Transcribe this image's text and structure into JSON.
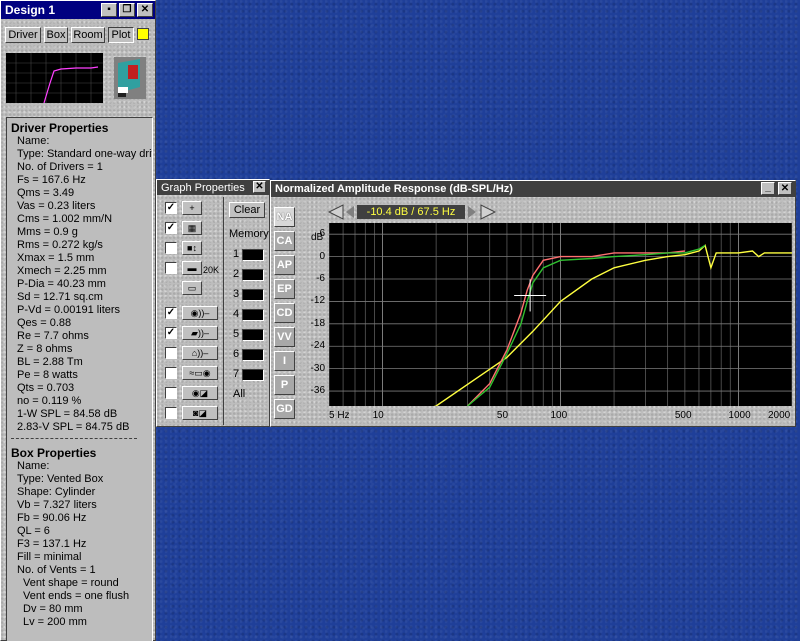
{
  "design": {
    "title": "Design 1",
    "tabs": [
      "Driver",
      "Box",
      "Room",
      "Plot"
    ],
    "driver_heading": "Driver Properties",
    "driver_lines": [
      "Name:",
      "Type: Standard one-way driver",
      "No. of Drivers = 1",
      "Fs =  167.6 Hz",
      "Qms =  3.49",
      "Vas =  0.23 liters",
      "Cms =  1.002 mm/N",
      "Mms =  0.9 g",
      "Rms =  0.272 kg/s",
      "Xmax =  1.5 mm",
      "Xmech =  2.25 mm",
      "P-Dia =  40.23 mm",
      "Sd =  12.71 sq.cm",
      "P-Vd =  0.00191 liters",
      "Qes =  0.88",
      "Re =  7.7 ohms",
      "Z =  8 ohms",
      "BL =  2.88 Tm",
      "Pe =  8 watts",
      "Qts =  0.703",
      "no =  0.119 %",
      "1-W SPL =  84.58 dB",
      "2.83-V SPL =  84.75 dB"
    ],
    "box_heading": "Box Properties",
    "box_lines": [
      "Name:",
      "Type: Vented Box",
      "Shape: Cylinder",
      "Vb =  7.327 liters",
      "Fb =  90.06 Hz",
      "QL =  6",
      "F3 =  137.1 Hz",
      "Fill = minimal",
      "No. of Vents = 1",
      "Vent shape = round",
      "Vent ends = one flush",
      "Dv =  80 mm",
      "Lv =  200 mm"
    ]
  },
  "graph_props": {
    "title": "Graph Properties",
    "clear_label": "Clear",
    "memory_label": "Memory",
    "memory_slots": [
      "1",
      "2",
      "3",
      "4",
      "5",
      "6",
      "7"
    ],
    "all_label": "All",
    "checks": [
      true,
      true,
      false,
      false,
      false,
      true,
      true,
      false,
      false,
      false,
      false
    ],
    "icon_20k": "20K"
  },
  "graph": {
    "title": "Normalized Amplitude Response (dB-SPL/Hz)",
    "readout": "-10.4 dB / 67.5 Hz",
    "side_tabs": [
      "NA",
      "CA",
      "AP",
      "EP",
      "CD",
      "VV",
      "I",
      "P",
      "GD"
    ],
    "y_unit": "dB",
    "y_ticks": [
      "6",
      "0",
      "-6",
      "-12",
      "-18",
      "-24",
      "-30",
      "-36"
    ],
    "x_ticks": [
      "5 Hz",
      "10",
      "50",
      "100",
      "500",
      "1000",
      "2000"
    ]
  },
  "chart_data": {
    "type": "line",
    "title": "Normalized Amplitude Response (dB-SPL/Hz)",
    "xlabel": "",
    "ylabel": "dB",
    "x_scale": "log",
    "xlim": [
      5,
      2000
    ],
    "ylim": [
      -40,
      9
    ],
    "grid": true,
    "series": [
      {
        "color": "#ffff40",
        "points": [
          [
            5,
            -48
          ],
          [
            20,
            -40
          ],
          [
            50,
            -27
          ],
          [
            70,
            -20
          ],
          [
            100,
            -12
          ],
          [
            150,
            -6
          ],
          [
            200,
            -3
          ],
          [
            300,
            -1
          ],
          [
            400,
            0
          ],
          [
            500,
            0.5
          ],
          [
            600,
            1.5
          ],
          [
            650,
            3
          ],
          [
            700,
            -3
          ],
          [
            750,
            1
          ],
          [
            1000,
            1
          ],
          [
            1200,
            1.5
          ],
          [
            1300,
            0
          ],
          [
            1400,
            1
          ],
          [
            2000,
            1
          ]
        ]
      },
      {
        "color": "#ff7070",
        "points": [
          [
            30,
            -40
          ],
          [
            40,
            -34
          ],
          [
            50,
            -25
          ],
          [
            60,
            -15
          ],
          [
            65,
            -9
          ],
          [
            70,
            -5
          ],
          [
            80,
            -1
          ],
          [
            100,
            0
          ],
          [
            150,
            0
          ],
          [
            200,
            1
          ],
          [
            300,
            1
          ],
          [
            400,
            1
          ],
          [
            500,
            1.5
          ]
        ]
      },
      {
        "color": "#30c030",
        "points": [
          [
            30,
            -40
          ],
          [
            40,
            -35
          ],
          [
            50,
            -26
          ],
          [
            60,
            -18
          ],
          [
            65,
            -12
          ],
          [
            70,
            -7
          ],
          [
            80,
            -3
          ],
          [
            100,
            -1
          ],
          [
            150,
            -0.5
          ],
          [
            200,
            0
          ],
          [
            300,
            0.5
          ],
          [
            400,
            1
          ],
          [
            500,
            1
          ],
          [
            600,
            2
          ],
          [
            650,
            3
          ]
        ]
      }
    ]
  }
}
